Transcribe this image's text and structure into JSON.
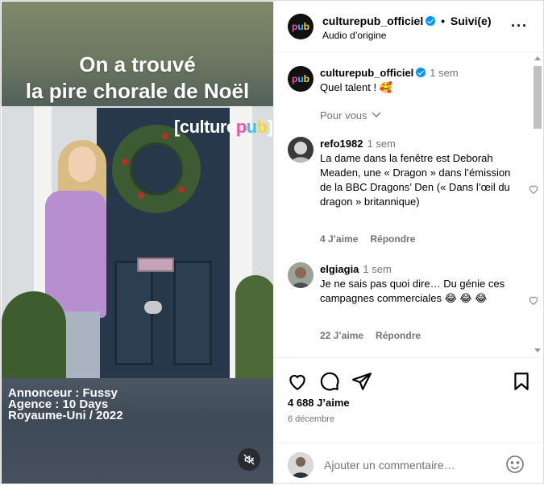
{
  "video": {
    "title_line1": "On a trouvé",
    "title_line2": "la pire chorale de Noël",
    "brand_overlay": {
      "open": "[",
      "culture": "culture",
      "p1": "p",
      "p2": "u",
      "p3": "b",
      "close": "]"
    },
    "credit_advertiser": "Annonceur : Fussy",
    "credit_agency": "Agence : 10 Days",
    "credit_country": "Royaume-Uni / 2022",
    "mute_icon": "muted-speaker-icon"
  },
  "header": {
    "avatar_text": {
      "a": "p",
      "b": "u",
      "c": "b"
    },
    "username": "culturepub_officiel",
    "separator": "•",
    "follow_status": "Suivi(e)",
    "audio": "Audio d’origine",
    "more": "···"
  },
  "caption": {
    "username": "culturepub_officiel",
    "time": "1 sem",
    "text": "Quel talent ! 🥰"
  },
  "pour_vous": "Pour vous",
  "comments": [
    {
      "username": "refo1982",
      "time": "1 sem",
      "text": "La dame dans la fenêtre est Deborah Meaden, une « Dragon » dans l’émission de la BBC Dragons’ Den (« Dans l’œil du dragon » britannique)",
      "likes": "4 J’aime",
      "reply": "Répondre"
    },
    {
      "username": "elgiagia",
      "time": "1 sem",
      "text": "Je ne sais pas quoi dire… Du génie ces campagnes commerciales 😂 😂 😂",
      "likes": "22 J’aime",
      "reply": "Répondre"
    }
  ],
  "actions": {
    "likes": "4 688 J’aime",
    "date": "6 décembre",
    "comment_placeholder": "Ajouter un commentaire…"
  },
  "colors": {
    "verified": "#0095f6",
    "muted_text": "#737373",
    "brand_pink": "#ff4fa3",
    "brand_blue": "#30c5ff",
    "brand_yellow": "#ffd23c"
  }
}
